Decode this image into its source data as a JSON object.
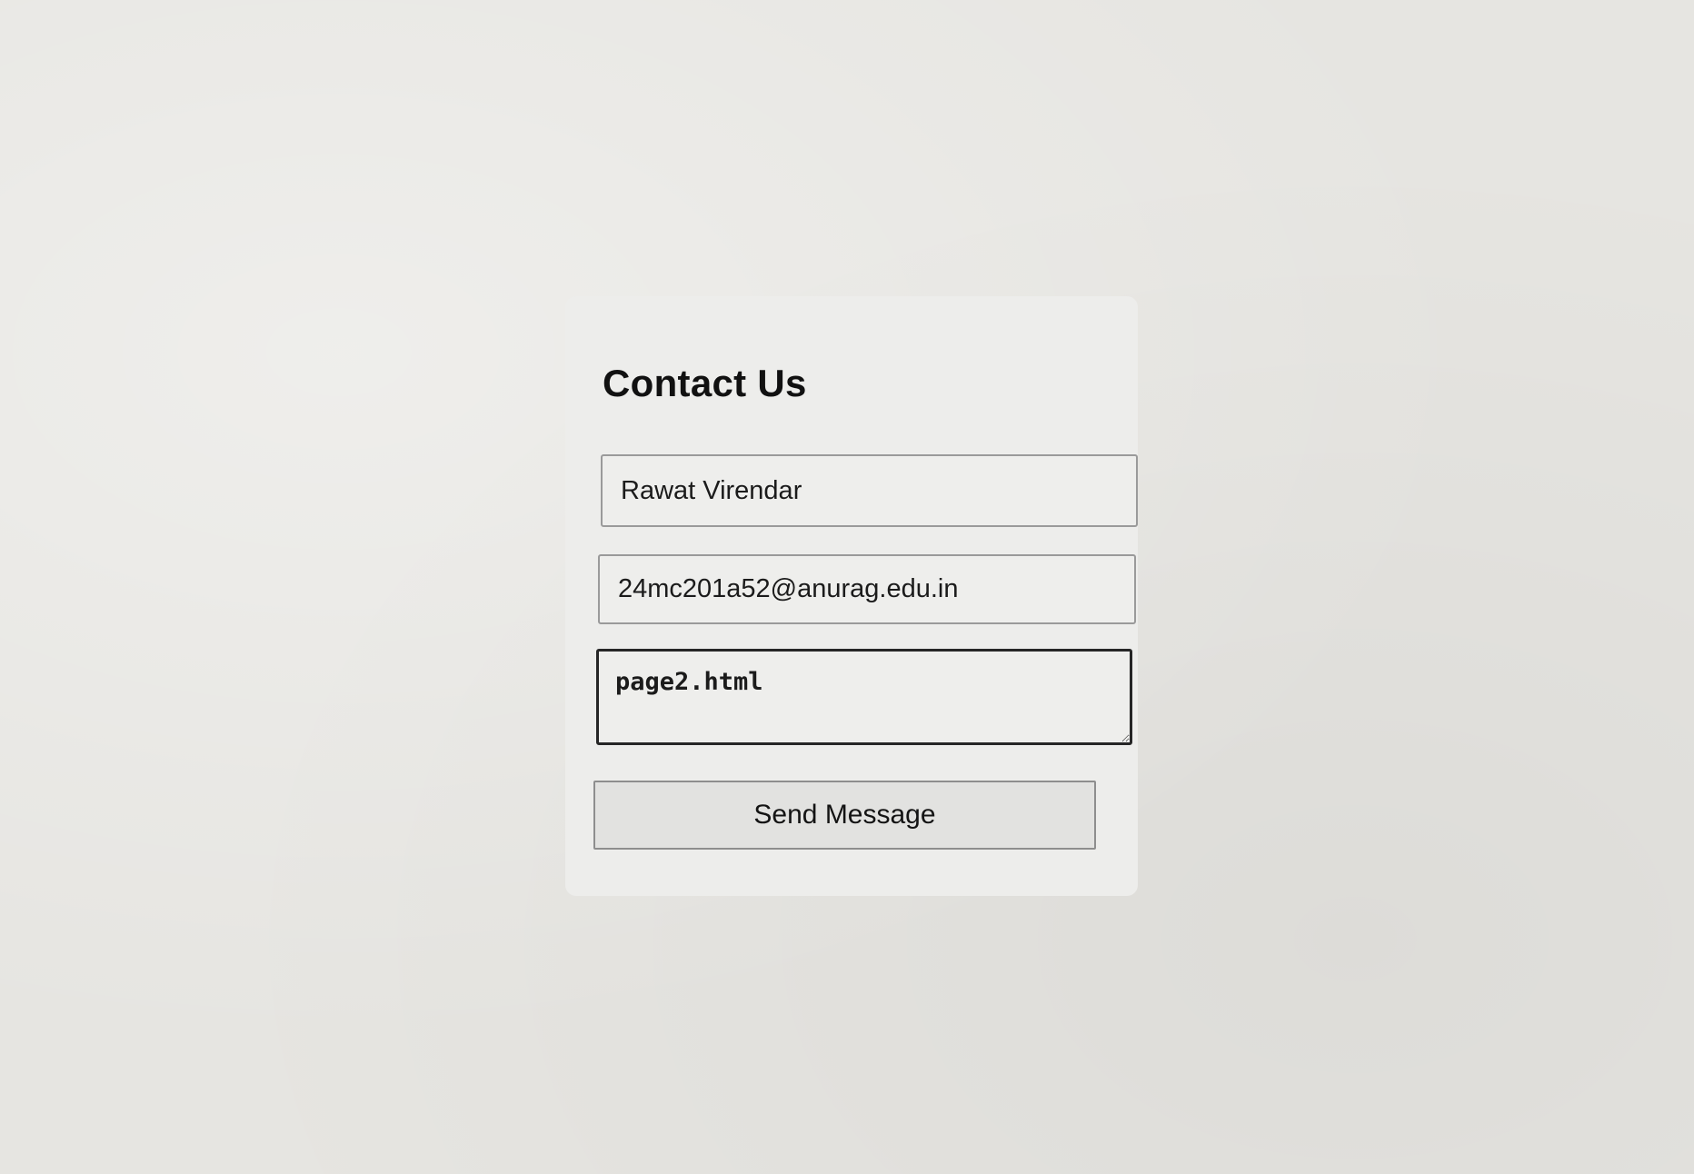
{
  "form": {
    "title": "Contact Us",
    "name_value": "Rawat Virendar",
    "email_value": "24mc201a52@anurag.edu.in",
    "message_value": "page2.html",
    "submit_label": "Send Message"
  },
  "colors": {
    "background": "#e6e5e1",
    "card": "#ededeb",
    "text": "#111111",
    "field_border": "#9a9a9a",
    "focused_border": "#262626"
  }
}
